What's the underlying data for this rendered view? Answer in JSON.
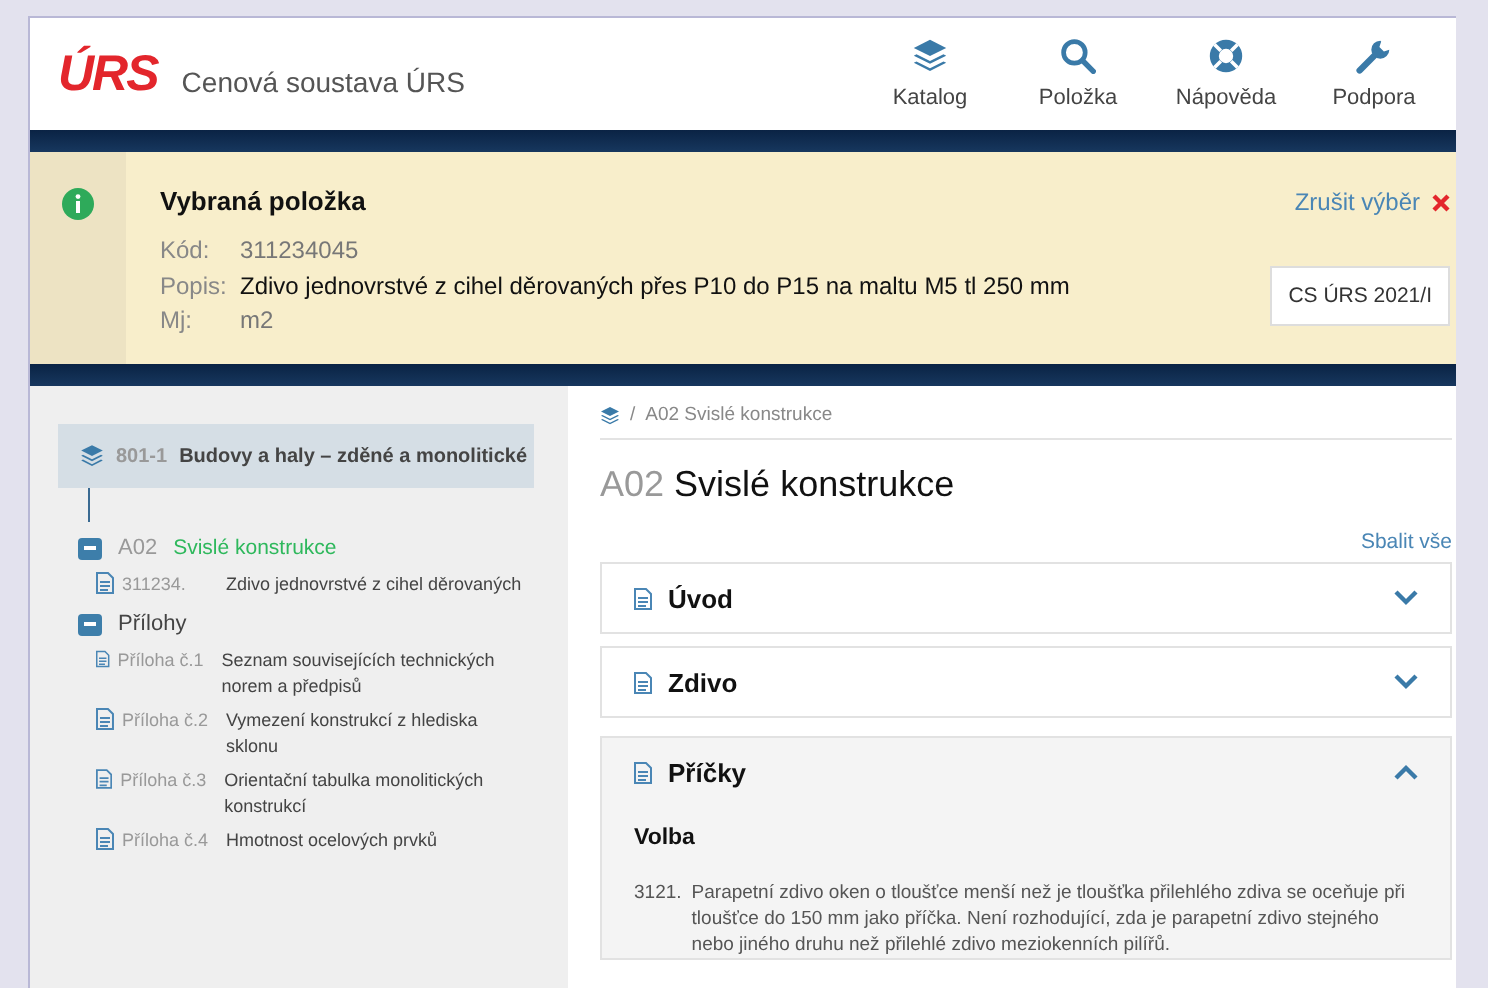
{
  "header": {
    "logo": "ÚRS",
    "app_title": "Cenová soustava ÚRS",
    "nav": [
      {
        "kind": "layers",
        "label": "Katalog"
      },
      {
        "kind": "search",
        "label": "Položka"
      },
      {
        "kind": "help",
        "label": "Nápověda"
      },
      {
        "kind": "wrench",
        "label": "Podpora"
      }
    ]
  },
  "selection": {
    "title": "Vybraná položka",
    "clear_label": "Zrušit výběr",
    "fields": [
      {
        "label": "Kód:",
        "value": "311234045",
        "muted": true
      },
      {
        "label": "Popis:",
        "value": "Zdivo jednovrstvé z cihel děrovaných přes P10 do P15 na maltu M5 tl 250 mm",
        "muted": false
      },
      {
        "label": "Mj:",
        "value": "m2",
        "muted": true
      }
    ],
    "version_button": "CS ÚRS 2021/I"
  },
  "sidebar": {
    "root": {
      "code": "801-1",
      "title": "Budovy a haly – zděné a monolitické"
    },
    "tree": [
      {
        "code": "A02",
        "title": "Svislé konstrukce",
        "expanded": true,
        "selected": true,
        "children": [
          {
            "code": "311234.",
            "title": "Zdivo jednovrstvé z cihel děrovaných"
          }
        ]
      },
      {
        "title": "Přílohy",
        "expanded": true,
        "selected": false,
        "children": [
          {
            "code": "Příloha č.1",
            "title": "Seznam souvisejících technických norem a předpisů"
          },
          {
            "code": "Příloha č.2",
            "title": "Vymezení konstrukcí z hlediska sklonu"
          },
          {
            "code": "Příloha č.3",
            "title": "Orientační tabulka monolitických konstrukcí"
          },
          {
            "code": "Příloha č.4",
            "title": "Hmotnost ocelových prvků"
          }
        ]
      }
    ]
  },
  "content": {
    "breadcrumb_separator": "/",
    "breadcrumb": "A02 Svislé konstrukce",
    "heading": {
      "code": "A02",
      "title": "Svislé konstrukce"
    },
    "collapse_all": "Sbalit vše",
    "sections": [
      {
        "title": "Úvod",
        "expanded": false
      },
      {
        "title": "Zdivo",
        "expanded": false
      },
      {
        "title": "Příčky",
        "expanded": true,
        "subheading": "Volba",
        "paragraphs": [
          {
            "number": "3121.",
            "text": "Parapetní zdivo oken o tloušťce menší než je tloušťka přilehlého zdiva se oceňuje při tloušťce do 150 mm jako příčka. Není rozhodující, zda je parapetní zdivo stejného nebo jiného druhu než přilehlé zdivo meziokenních pilířů."
          }
        ]
      }
    ]
  }
}
